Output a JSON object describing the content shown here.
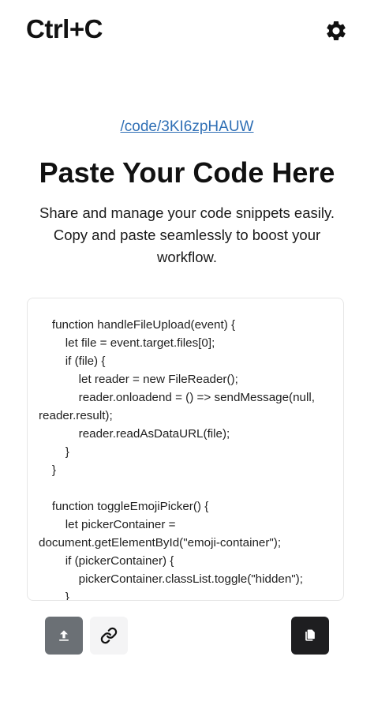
{
  "header": {
    "logo": "Ctrl+C",
    "settings_icon": "gear-icon"
  },
  "share": {
    "link_text": "/code/3KI6zpHAUW"
  },
  "hero": {
    "title": "Paste Your Code Here",
    "subtitle": "Share and manage your code snippets easily. Copy and paste seamlessly to boost your workflow."
  },
  "editor": {
    "content": "    function handleFileUpload(event) {\n        let file = event.target.files[0];\n        if (file) {\n            let reader = new FileReader();\n            reader.onloadend = () => sendMessage(null, reader.result);\n            reader.readAsDataURL(file);\n        }\n    }\n\n    function toggleEmojiPicker() {\n        let pickerContainer = document.getElementById(\"emoji-container\");\n        if (pickerContainer) {\n            pickerContainer.classList.toggle(\"hidden\");\n        }\n    }"
  },
  "toolbar": {
    "upload_icon": "upload-icon",
    "link_icon": "link-icon",
    "copy_icon": "copy-icon"
  },
  "colors": {
    "link": "#2f6fb5",
    "upload_button": "#6b7075",
    "link_button": "#f4f4f5",
    "copy_button": "#1e1e20"
  }
}
